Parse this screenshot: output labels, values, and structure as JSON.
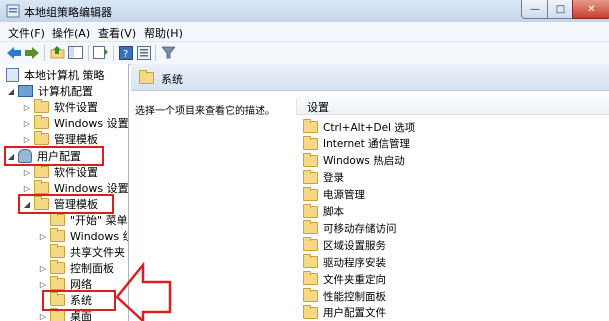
{
  "window": {
    "title": "本地组策略编辑器",
    "min": "—",
    "max": "□",
    "close": "✕"
  },
  "menu": [
    {
      "label": "文件(F)"
    },
    {
      "label": "操作(A)"
    },
    {
      "label": "查看(V)"
    },
    {
      "label": "帮助(H)"
    }
  ],
  "toolbar": {
    "back": "back-icon",
    "forward": "forward-icon",
    "up": "up-folder-icon",
    "showhide": "console-tree-icon",
    "export": "export-icon",
    "help": "help-icon",
    "props": "properties-icon",
    "filter": "filter-icon"
  },
  "tree": {
    "root": "本地计算机 策略",
    "computer_config": "计算机配置",
    "cc_software": "软件设置",
    "cc_windows": "Windows 设置",
    "cc_admin": "管理模板",
    "user_config": "用户配置",
    "uc_software": "软件设置",
    "uc_windows": "Windows 设置",
    "uc_admin": "管理模板",
    "start_menu": "\"开始\" 菜单",
    "windows_components": "Windows 组",
    "shared_folders": "共享文件夹",
    "control_panel": "控制面板",
    "network": "网络",
    "system": "系统",
    "desktop": "桌面"
  },
  "right": {
    "header": "系统",
    "description": "选择一个项目来查看它的描述。",
    "column": "设置",
    "items": [
      "Ctrl+Alt+Del 选项",
      "Internet 通信管理",
      "Windows 热启动",
      "登录",
      "电源管理",
      "脚本",
      "可移动存储访问",
      "区域设置服务",
      "驱动程序安装",
      "文件夹重定向",
      "性能控制面板",
      "用户配置文件"
    ]
  },
  "colors": {
    "annotation": "#d82020",
    "folder": "#f6d885",
    "header": "#d7e3f2"
  }
}
